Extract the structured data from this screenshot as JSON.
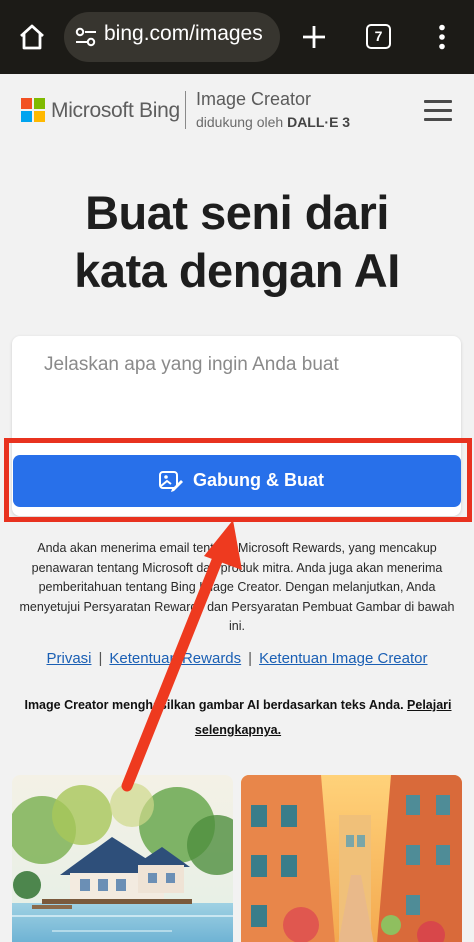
{
  "browser": {
    "url": "bing.com/images",
    "tab_count": "7",
    "icons": [
      "home-icon",
      "site-settings-icon",
      "new-tab-plus-icon",
      "tab-switcher-icon",
      "more-vert-icon"
    ]
  },
  "header": {
    "logo_text": "Microsoft Bing",
    "product_name": "Image Creator",
    "powered_by_prefix": "didukung oleh",
    "powered_by_model": "DALL·E 3"
  },
  "hero": {
    "title_line1": "Buat seni dari",
    "title_line2": "kata dengan AI"
  },
  "prompt": {
    "placeholder": "Jelaskan apa yang ingin Anda buat"
  },
  "join_button": {
    "label": "Gabung & Buat"
  },
  "disclaimer": "Anda akan menerima email tentang Microsoft Rewards, yang mencakup penawaran tentang Microsoft dan produk mitra. Anda juga akan menerima pemberitahuan tentang Bing Image Creator. Dengan melanjutkan, Anda menyetujui Persyaratan Rewards dan Persyaratan Pembuat Gambar di bawah ini.",
  "links": {
    "privacy": "Privasi",
    "rewards_terms": "Ketentuan Rewards",
    "creator_terms": "Ketentuan Image Creator",
    "separator": "|"
  },
  "info": {
    "text": "Image Creator menghasilkan gambar AI berdasarkan teks Anda.",
    "learn_more": "Pelajari selengkapnya."
  },
  "colors": {
    "accent": "#2870ea",
    "highlight": "#e8321f",
    "browser_bar": "#1c1b17"
  }
}
